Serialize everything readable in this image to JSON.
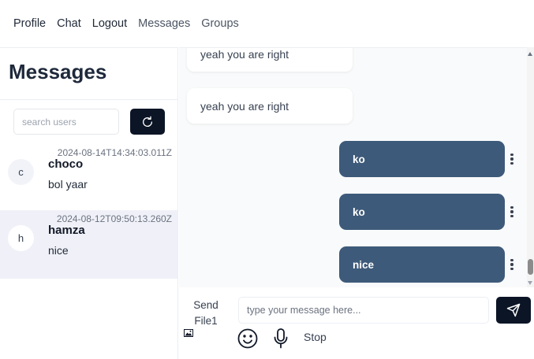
{
  "nav": {
    "profile": "Profile",
    "chat": "Chat",
    "logout": "Logout",
    "messages": "Messages",
    "groups": "Groups"
  },
  "sidebar": {
    "title": "Messages",
    "search_placeholder": "search users",
    "refresh_icon": "refresh-icon",
    "conversations": [
      {
        "initial": "c",
        "name": "choco",
        "timestamp": "2024-08-14T14:34:03.011Z",
        "preview": "bol yaar",
        "active": false
      },
      {
        "initial": "h",
        "name": "hamza",
        "timestamp": "2024-08-12T09:50:13.260Z",
        "preview": "nice",
        "active": true
      }
    ]
  },
  "chat": {
    "messages": [
      {
        "direction": "incoming",
        "text": "yeah you are right"
      },
      {
        "direction": "incoming",
        "text": "yeah you are right"
      },
      {
        "direction": "outgoing",
        "text": "ko"
      },
      {
        "direction": "outgoing",
        "text": "ko"
      },
      {
        "direction": "outgoing",
        "text": "nice"
      }
    ],
    "outgoing_bubble_color": "#3e5a7a"
  },
  "composer": {
    "send_file_label": "Send File1",
    "input_placeholder": "type your message here...",
    "input_value": "",
    "stop_label": "Stop",
    "icons": [
      "image-icon",
      "send-icon",
      "emoji-icon",
      "microphone-icon"
    ]
  },
  "colors": {
    "primary_button": "#0b1526",
    "active_conversation_bg": "#f0f1f8"
  }
}
